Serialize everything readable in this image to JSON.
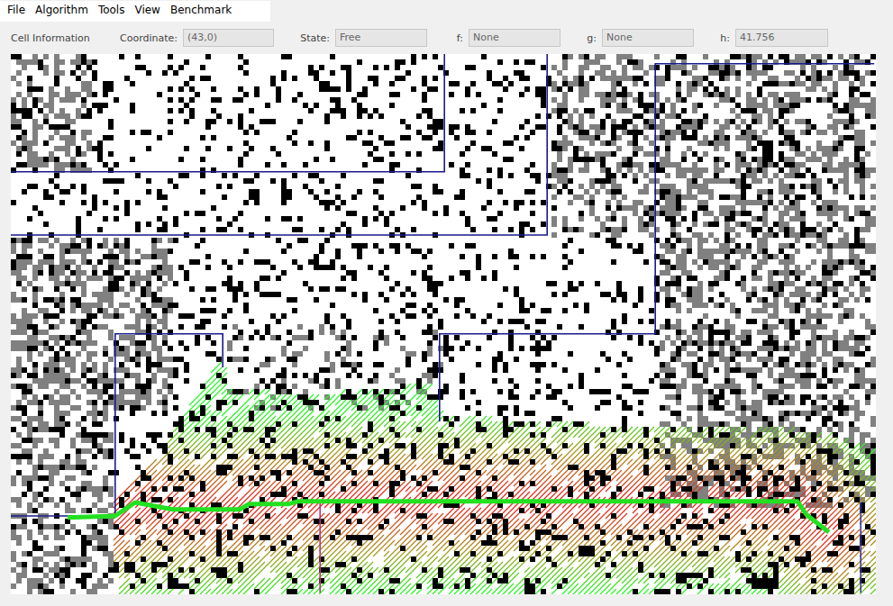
{
  "menu": [
    "File",
    "Algorithm",
    "Tools",
    "View",
    "Benchmark"
  ],
  "info": {
    "title": "Cell Information",
    "fields": [
      {
        "label": "Coordinate:",
        "value": "(43,0)"
      },
      {
        "label": "State:",
        "value": "Free"
      },
      {
        "label": "f:",
        "value": "None"
      },
      {
        "label": "g:",
        "value": "None"
      },
      {
        "label": "h:",
        "value": "41.756"
      }
    ]
  },
  "grid": {
    "cols": 160,
    "rows": 100,
    "seed": 7,
    "obstacle_density": 0.17,
    "gray_zones": [
      [
        0,
        0,
        15,
        22,
        0.4
      ],
      [
        0,
        34,
        30,
        66,
        0.45
      ],
      [
        0,
        66,
        19,
        100,
        0.4
      ],
      [
        100,
        0,
        120,
        34,
        0.4
      ],
      [
        120,
        0,
        160,
        84,
        0.42
      ],
      [
        40,
        50,
        80,
        66,
        0.15
      ]
    ]
  },
  "boundaries": [
    {
      "points": [
        [
          0,
          21.8
        ],
        [
          80.2,
          21.8
        ],
        [
          80.2,
          0
        ]
      ],
      "color": "#1a1a8c"
    },
    {
      "points": [
        [
          0,
          33.5
        ],
        [
          99.2,
          33.5
        ],
        [
          99.2,
          0
        ]
      ],
      "color": "#1a1a8c"
    },
    {
      "points": [
        [
          159.7,
          1.8
        ],
        [
          119.2,
          1.8
        ],
        [
          119.2,
          51.8
        ],
        [
          79.3,
          51.8
        ],
        [
          79.3,
          68
        ]
      ],
      "color": "#1a1a8c"
    },
    {
      "points": [
        [
          0,
          85.5
        ],
        [
          19.3,
          85.5
        ],
        [
          19.3,
          51.8
        ],
        [
          39.2,
          51.8
        ],
        [
          39.2,
          58
        ]
      ],
      "color": "#1a1a8c"
    },
    {
      "points": [
        [
          57.2,
          83
        ],
        [
          57.2,
          99.7
        ]
      ],
      "color": "#b03a7a"
    },
    {
      "points": [
        [
          157.2,
          83
        ],
        [
          157.2,
          99.7
        ]
      ],
      "color": "#3a3aa0"
    }
  ],
  "explored": {
    "polygon": [
      [
        19.7,
        99.8
      ],
      [
        19,
        83
      ],
      [
        28,
        73
      ],
      [
        38.8,
        56
      ],
      [
        40.5,
        62
      ],
      [
        55,
        63
      ],
      [
        78,
        61
      ],
      [
        80,
        67
      ],
      [
        100,
        68
      ],
      [
        120,
        69.5
      ],
      [
        135,
        68.5
      ],
      [
        150,
        70
      ],
      [
        160,
        73
      ],
      [
        160,
        99.8
      ]
    ]
  },
  "path": {
    "points": [
      [
        10.5,
        85.8
      ],
      [
        19.3,
        85.5
      ],
      [
        23,
        83
      ],
      [
        30,
        84.3
      ],
      [
        42.3,
        84.3
      ],
      [
        44,
        83.3
      ],
      [
        51.3,
        83.3
      ],
      [
        53,
        82.8
      ],
      [
        145.5,
        82.8
      ],
      [
        147.2,
        85.3
      ],
      [
        151.3,
        88.5
      ]
    ]
  }
}
